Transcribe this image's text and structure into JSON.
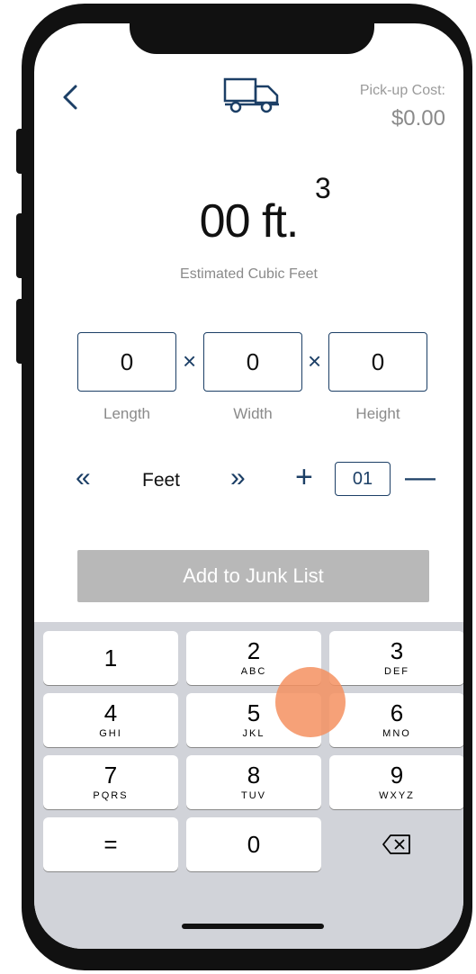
{
  "header": {
    "pickup_cost_label": "Pick-up Cost:",
    "pickup_cost_value": "$0.00"
  },
  "volume": {
    "value": "00 ft.",
    "superscript": "3",
    "label": "Estimated Cubic Feet"
  },
  "dimensions": [
    {
      "value": "0",
      "label": "Length"
    },
    {
      "value": "0",
      "label": "Width"
    },
    {
      "value": "0",
      "label": "Height"
    }
  ],
  "times_symbol": "×",
  "units": {
    "prev_arrow": "«",
    "unit_label": "Feet",
    "next_arrow": "»",
    "plus": "+",
    "quantity": "01",
    "minus": "—"
  },
  "add_button": "Add to Junk List",
  "keypad": {
    "keys": [
      {
        "num": "1",
        "letters": ""
      },
      {
        "num": "2",
        "letters": "ABC"
      },
      {
        "num": "3",
        "letters": "DEF"
      },
      {
        "num": "4",
        "letters": "GHI"
      },
      {
        "num": "5",
        "letters": "JKL"
      },
      {
        "num": "6",
        "letters": "MNO"
      },
      {
        "num": "7",
        "letters": "PQRS"
      },
      {
        "num": "8",
        "letters": "TUV"
      },
      {
        "num": "9",
        "letters": "WXYZ"
      },
      {
        "num": "=",
        "letters": ""
      },
      {
        "num": "0",
        "letters": ""
      }
    ]
  },
  "colors": {
    "accent": "#1c3f66",
    "button_disabled": "#b8b8b8",
    "touch_indicator": "#f49160"
  }
}
